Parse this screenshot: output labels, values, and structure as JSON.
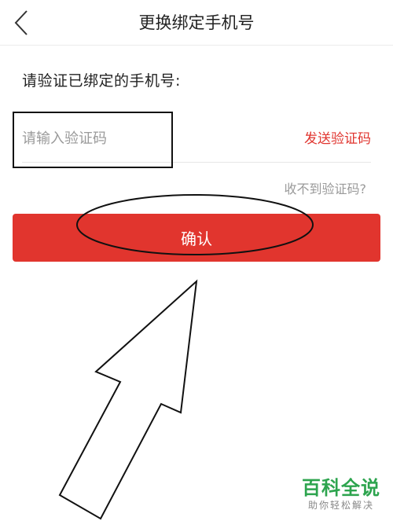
{
  "header": {
    "back_icon": "chevron-left-icon",
    "title": "更换绑定手机号"
  },
  "form": {
    "instruction": "请验证已绑定的手机号:",
    "code_placeholder": "请输入验证码",
    "code_value": "",
    "send_code_label": "发送验证码",
    "no_code_label": "收不到验证码?"
  },
  "actions": {
    "confirm_label": "确认"
  },
  "watermark": {
    "title": "百科全说",
    "subtitle": "助你轻松解决"
  },
  "colors": {
    "accent": "#e1352e",
    "watermark": "#2da44e"
  }
}
